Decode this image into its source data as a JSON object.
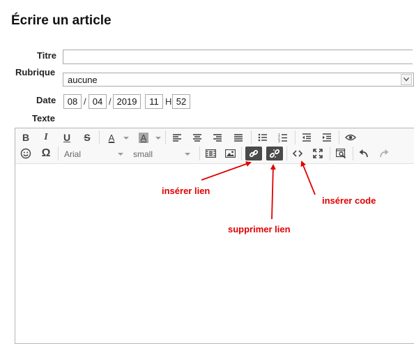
{
  "page": {
    "title": "Écrire un article"
  },
  "form": {
    "titre_label": "Titre",
    "titre_value": "",
    "rubrique_label": "Rubrique",
    "rubrique_value": "aucune",
    "date_label": "Date",
    "date_day": "08",
    "date_month": "04",
    "date_year": "2019",
    "date_sep": "/",
    "time_hour": "11",
    "time_sep": "H",
    "time_minute": "52",
    "texte_label": "Texte"
  },
  "toolbar": {
    "bold": "B",
    "italic": "I",
    "underline": "U",
    "strike": "S",
    "text_color": "A",
    "bg_color": "A",
    "omega": "Ω",
    "font_value": "Arial",
    "size_value": "small",
    "active_bg_color": "#4a4a4a"
  },
  "annotations": {
    "insert_link": "insérer lien",
    "remove_link": "supprimer lien",
    "insert_code": "insérer code",
    "color": "#e00000"
  }
}
